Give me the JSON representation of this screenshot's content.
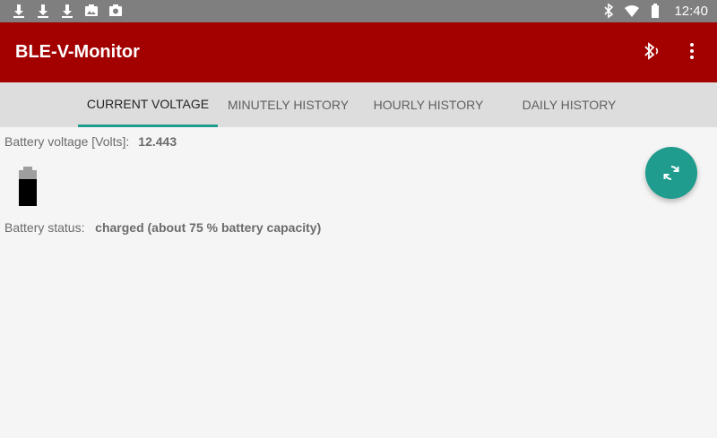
{
  "status_bar": {
    "time": "12:40",
    "left_icons": [
      "download-icon",
      "download-icon",
      "download-icon",
      "photo-icon",
      "photo-icon"
    ],
    "right_icons": [
      "bluetooth-icon",
      "wifi-icon",
      "battery-icon"
    ]
  },
  "app_bar": {
    "title": "BLE-V-Monitor",
    "color": "#a30000",
    "actions": [
      "bluetooth-connected-icon",
      "overflow-menu-icon"
    ]
  },
  "tabs": [
    {
      "label": "CURRENT VOLTAGE",
      "active": true
    },
    {
      "label": "MINUTELY HISTORY",
      "active": false
    },
    {
      "label": "HOURLY HISTORY",
      "active": false
    },
    {
      "label": "DAILY HISTORY",
      "active": false
    }
  ],
  "accent_color": "#1f9c8d",
  "current_voltage": {
    "voltage_label": "Battery voltage [Volts]:",
    "voltage_value": "12.443",
    "battery_level_fraction": 0.75,
    "status_label": "Battery status:",
    "status_value": "charged (about 75 % battery capacity)"
  },
  "fab": {
    "icon": "refresh-icon"
  }
}
